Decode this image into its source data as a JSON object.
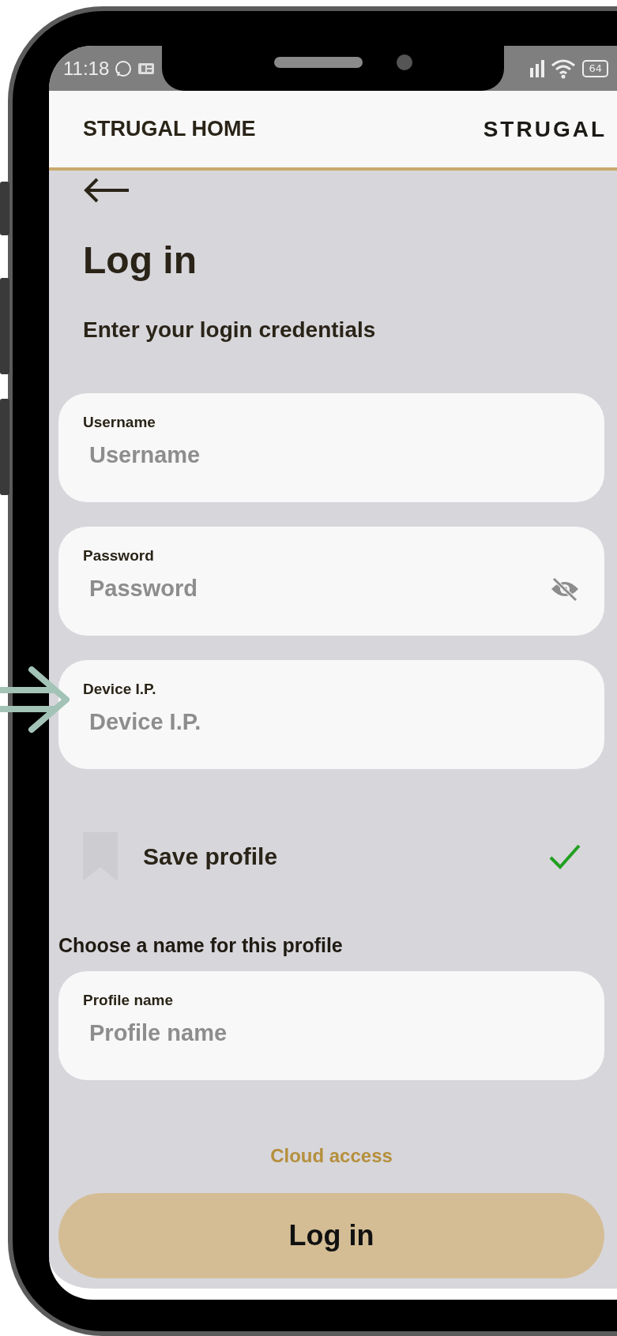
{
  "status_bar": {
    "time": "11:18",
    "battery": "64"
  },
  "header": {
    "title": "STRUGAL HOME",
    "logo": "STRUGAL"
  },
  "page": {
    "title": "Log in",
    "subtitle": "Enter your login credentials"
  },
  "fields": [
    {
      "label": "Username",
      "placeholder": "Username",
      "kind": "text"
    },
    {
      "label": "Password",
      "placeholder": "Password",
      "kind": "password"
    },
    {
      "label": "Device I.P.",
      "placeholder": "Device I.P.",
      "kind": "text"
    }
  ],
  "save_profile": {
    "label": "Save profile",
    "checked": true
  },
  "profile_section": {
    "heading": "Choose a name for this profile",
    "field": {
      "label": "Profile name",
      "placeholder": "Profile name"
    }
  },
  "cloud_link": "Cloud access",
  "login_button": "Log in"
}
